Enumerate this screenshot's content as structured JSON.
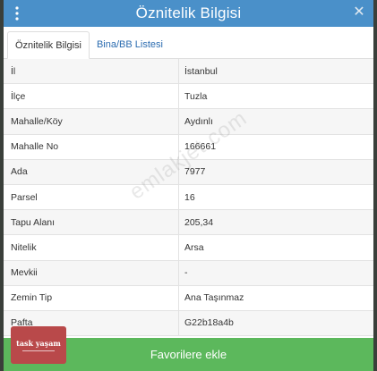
{
  "modal": {
    "title": "Öznitelik Bilgisi"
  },
  "tabs": [
    {
      "label": "Öznitelik Bilgisi"
    },
    {
      "label": "Bina/BB Listesi"
    }
  ],
  "attributes": [
    {
      "key": "İl",
      "value": "İstanbul"
    },
    {
      "key": "İlçe",
      "value": "Tuzla"
    },
    {
      "key": "Mahalle/Köy",
      "value": "Aydınlı"
    },
    {
      "key": "Mahalle No",
      "value": "166661"
    },
    {
      "key": "Ada",
      "value": "7977"
    },
    {
      "key": "Parsel",
      "value": "16"
    },
    {
      "key": "Tapu Alanı",
      "value": "205,34"
    },
    {
      "key": "Nitelik",
      "value": "Arsa"
    },
    {
      "key": "Mevkii",
      "value": "-"
    },
    {
      "key": "Zemin Tip",
      "value": "Ana Taşınmaz"
    },
    {
      "key": "Pafta",
      "value": "G22b18a4b"
    }
  ],
  "footer": {
    "favorite_label": "Favorilere ekle"
  },
  "watermark": "emlakjet.com",
  "logo": {
    "text": "task yaşam"
  },
  "colors": {
    "header": "#4a90c9",
    "favorite_button": "#5cb85c",
    "logo_badge": "#b9494a"
  }
}
